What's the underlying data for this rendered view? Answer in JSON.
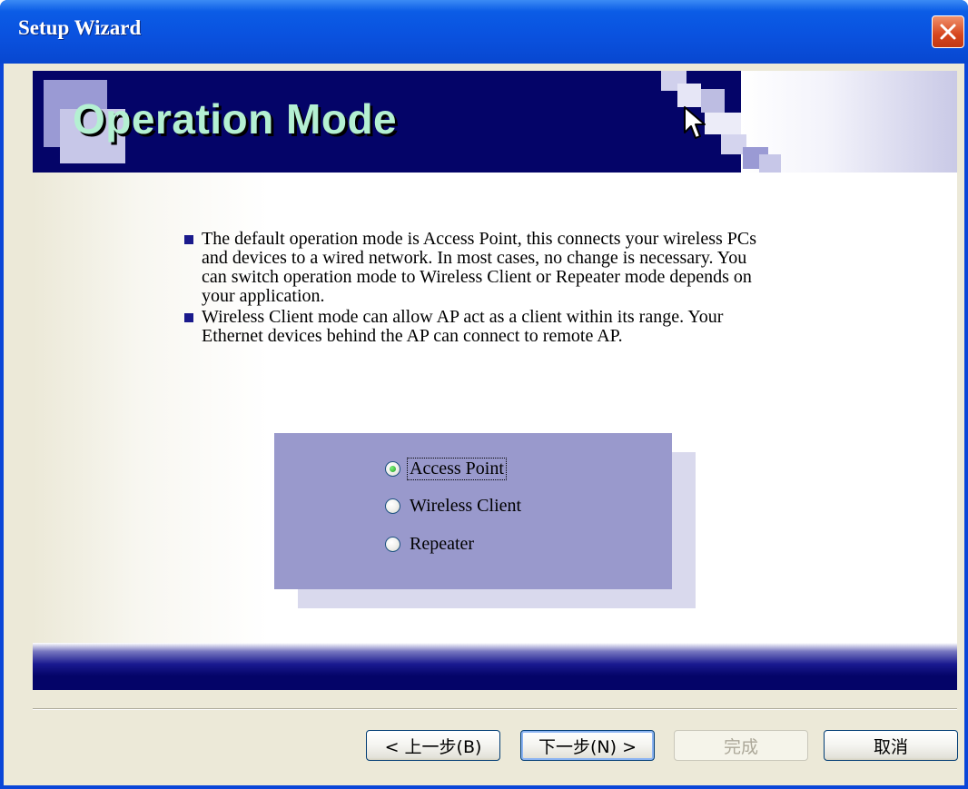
{
  "window": {
    "title": "Setup Wizard",
    "close_icon": "close-x-icon"
  },
  "header": {
    "title": "Operation Mode",
    "pointer_icon": "mouse-pointer-icon"
  },
  "description": {
    "items": [
      "The default operation mode is Access Point, this connects your wireless PCs and devices to a wired network. In most cases, no change is necessary. You can switch operation mode to Wireless Client or Repeater mode depends on your application.",
      "Wireless Client mode can allow AP act as a client within its range. Your Ethernet devices behind the AP can connect to remote AP."
    ]
  },
  "modes": {
    "selected": "Access Point",
    "options": [
      "Access Point",
      "Wireless Client",
      "Repeater"
    ]
  },
  "buttons": {
    "back": "< 上一步(B)",
    "next": "下一步(N) >",
    "finish": "完成",
    "cancel": "取消"
  },
  "colors": {
    "banner": "#040468",
    "title_text": "#b4f0d2",
    "panel": "#9999cc",
    "titlebar": "#0a52df",
    "close_button": "#d6461e"
  }
}
